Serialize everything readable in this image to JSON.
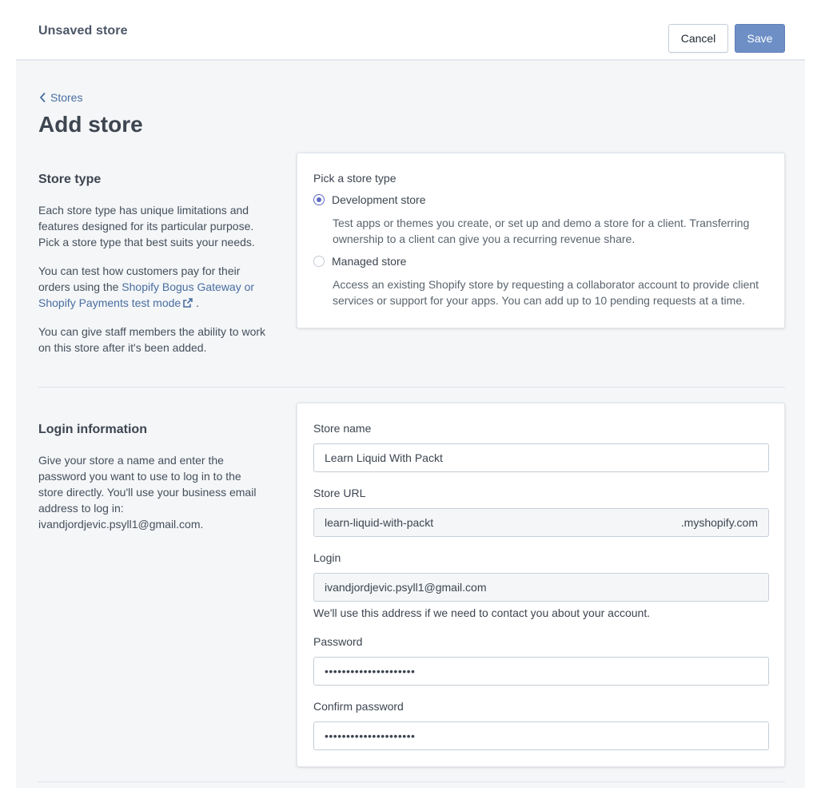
{
  "topbar": {
    "title": "Unsaved store",
    "cancel_label": "Cancel",
    "save_label": "Save"
  },
  "breadcrumb": {
    "icon": "chevron-left-icon",
    "label": "Stores"
  },
  "page_title": "Add store",
  "store_type_section": {
    "heading": "Store type",
    "paragraph1": "Each store type has unique limitations and features designed for its particular purpose. Pick a store type that best suits your needs.",
    "paragraph2_prefix": "You can test how customers pay for their orders using the ",
    "paragraph2_link": "Shopify Bogus Gateway or Shopify Payments test mode",
    "paragraph2_suffix": " .",
    "paragraph3": "You can give staff members the ability to work on this store after it's been added.",
    "card": {
      "label": "Pick a store type",
      "options": [
        {
          "label": "Development store",
          "selected": true,
          "description": "Test apps or themes you create, or set up and demo a store for a client. Transferring ownership to a client can give you a recurring revenue share."
        },
        {
          "label": "Managed store",
          "selected": false,
          "description": "Access an existing Shopify store by requesting a collaborator account to provide client services or support for your apps. You can add up to 10 pending requests at a time."
        }
      ]
    }
  },
  "login_section": {
    "heading": "Login information",
    "description": "Give your store a name and enter the password you want to use to log in to the store directly. You'll use your business email address to log in: ivandjordjevic.psyll1@gmail.com.",
    "card": {
      "store_name_label": "Store name",
      "store_name_value": "Learn Liquid With Packt",
      "store_url_label": "Store URL",
      "store_url_value": "learn-liquid-with-packt",
      "store_url_suffix": ".myshopify.com",
      "login_label": "Login",
      "login_value": "ivandjordjevic.psyll1@gmail.com",
      "login_help": "We'll use this address if we need to contact you about your account.",
      "password_label": "Password",
      "password_value": "•••••••••••••••••••••",
      "confirm_password_label": "Confirm password",
      "confirm_password_value": "•••••••••••••••••••••"
    }
  },
  "colors": {
    "primary": "#6d8fc6",
    "link": "#4a6ea0",
    "radio_selected": "#5c6ac4",
    "page_background": "#f4f6f8"
  }
}
